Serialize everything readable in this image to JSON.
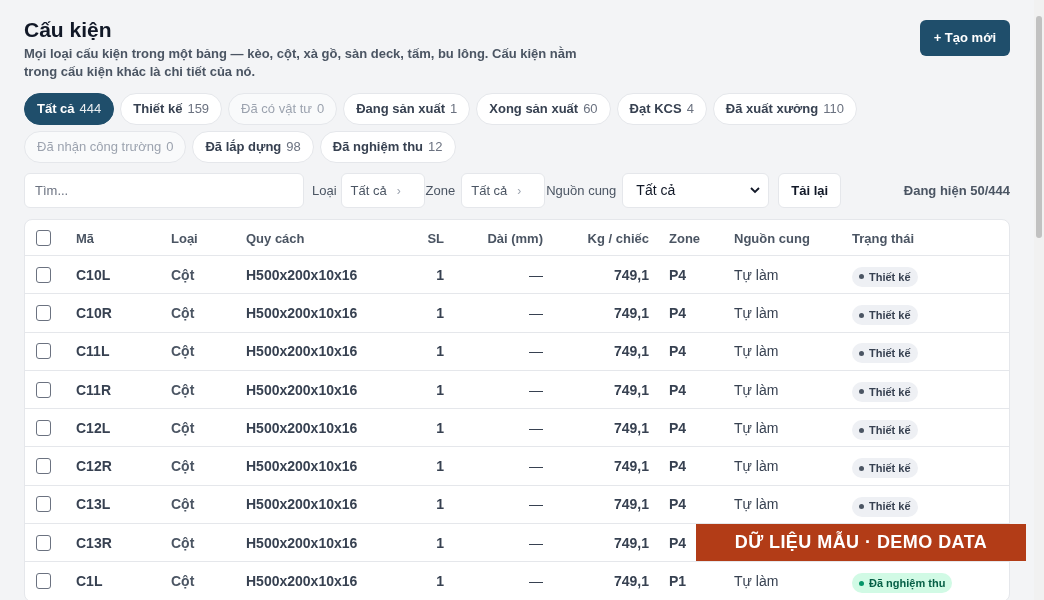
{
  "header": {
    "title": "Cấu kiện",
    "description": "Mọi loại cấu kiện trong một bảng — kèo, cột, xà gồ, sàn deck, tấm, bu lông. Cấu kiện nằm trong cấu kiện khác là chi tiết của nó.",
    "create_button": "+ Tạo mới"
  },
  "status_chips": [
    {
      "label": "Tất cả",
      "count": "444",
      "selected": true,
      "disabled": false
    },
    {
      "label": "Thiết kế",
      "count": "159",
      "selected": false,
      "disabled": false
    },
    {
      "label": "Đã có vật tư",
      "count": "0",
      "selected": false,
      "disabled": true
    },
    {
      "label": "Đang sản xuất",
      "count": "1",
      "selected": false,
      "disabled": false
    },
    {
      "label": "Xong sản xuất",
      "count": "60",
      "selected": false,
      "disabled": false
    },
    {
      "label": "Đạt KCS",
      "count": "4",
      "selected": false,
      "disabled": false
    },
    {
      "label": "Đã xuất xưởng",
      "count": "110",
      "selected": false,
      "disabled": false
    },
    {
      "label": "Đã nhận công trường",
      "count": "0",
      "selected": false,
      "disabled": true
    },
    {
      "label": "Đã lắp dựng",
      "count": "98",
      "selected": false,
      "disabled": false
    },
    {
      "label": "Đã nghiệm thu",
      "count": "12",
      "selected": false,
      "disabled": false
    }
  ],
  "filters": {
    "search_placeholder": "Tìm...",
    "type_label": "Loại",
    "type_value": "Tất cả",
    "type_chevron": "›",
    "zone_label": "Zone",
    "zone_value": "Tất cả",
    "zone_chevron": "›",
    "source_label": "Nguồn cung",
    "source_value": "Tất cả",
    "reload_button": "Tải lại",
    "showing": "Đang hiện 50/444"
  },
  "table": {
    "select_all_checked": false,
    "columns": [
      "Mã",
      "Loại",
      "Quy cách",
      "SL",
      "Dài (mm)",
      "Kg / chiếc",
      "Zone",
      "Nguồn cung",
      "Trạng thái"
    ],
    "rows": [
      {
        "checked": false,
        "code": "C10L",
        "type": "Cột",
        "spec": "H500x200x10x16",
        "qty": "1",
        "length": "—",
        "kg": "749,1",
        "zone": "P4",
        "source": "Tự làm",
        "status": {
          "label": "Thiết kế",
          "kind": "design"
        }
      },
      {
        "checked": false,
        "code": "C10R",
        "type": "Cột",
        "spec": "H500x200x10x16",
        "qty": "1",
        "length": "—",
        "kg": "749,1",
        "zone": "P4",
        "source": "Tự làm",
        "status": {
          "label": "Thiết kế",
          "kind": "design"
        }
      },
      {
        "checked": false,
        "code": "C11L",
        "type": "Cột",
        "spec": "H500x200x10x16",
        "qty": "1",
        "length": "—",
        "kg": "749,1",
        "zone": "P4",
        "source": "Tự làm",
        "status": {
          "label": "Thiết kế",
          "kind": "design"
        }
      },
      {
        "checked": false,
        "code": "C11R",
        "type": "Cột",
        "spec": "H500x200x10x16",
        "qty": "1",
        "length": "—",
        "kg": "749,1",
        "zone": "P4",
        "source": "Tự làm",
        "status": {
          "label": "Thiết kế",
          "kind": "design"
        }
      },
      {
        "checked": false,
        "code": "C12L",
        "type": "Cột",
        "spec": "H500x200x10x16",
        "qty": "1",
        "length": "—",
        "kg": "749,1",
        "zone": "P4",
        "source": "Tự làm",
        "status": {
          "label": "Thiết kế",
          "kind": "design"
        }
      },
      {
        "checked": false,
        "code": "C12R",
        "type": "Cột",
        "spec": "H500x200x10x16",
        "qty": "1",
        "length": "—",
        "kg": "749,1",
        "zone": "P4",
        "source": "Tự làm",
        "status": {
          "label": "Thiết kế",
          "kind": "design"
        }
      },
      {
        "checked": false,
        "code": "C13L",
        "type": "Cột",
        "spec": "H500x200x10x16",
        "qty": "1",
        "length": "—",
        "kg": "749,1",
        "zone": "P4",
        "source": "Tự làm",
        "status": {
          "label": "Thiết kế",
          "kind": "design"
        }
      },
      {
        "checked": false,
        "code": "C13R",
        "type": "Cột",
        "spec": "H500x200x10x16",
        "qty": "1",
        "length": "—",
        "kg": "749,1",
        "zone": "P4"
      },
      {
        "checked": false,
        "code": "C1L",
        "type": "Cột",
        "spec": "H500x200x10x16",
        "qty": "1",
        "length": "—",
        "kg": "749,1",
        "zone": "P1",
        "source": "Tự làm",
        "status": {
          "label": "Đã nghiệm thu",
          "kind": "accepted"
        }
      }
    ]
  },
  "demo_banner": "DỮ LIỆU MẪU · DEMO DATA"
}
